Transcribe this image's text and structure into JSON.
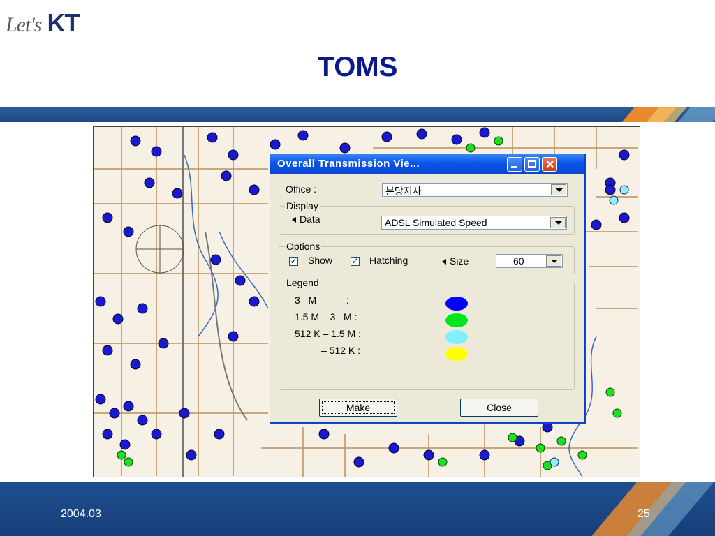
{
  "logo": {
    "lets": "Let's",
    "kt": "KT"
  },
  "slide_title": "TOMS",
  "dialog": {
    "title": "Overall Transmission Vie...",
    "office_label": "Office :",
    "office_value": "분당지사",
    "display_group": "Display",
    "data_label": "Data",
    "data_value": "ADSL Simulated Speed",
    "options_group": "Options",
    "show_label": "Show",
    "hatching_label": "Hatching",
    "size_label": "Size",
    "size_value": "60",
    "show_checked": true,
    "hatching_checked": true,
    "legend_group": "Legend",
    "legend": [
      {
        "label": "3   M –        :",
        "color": "#0000ff"
      },
      {
        "label": "1.5 M – 3   M :",
        "color": "#00e61e"
      },
      {
        "label": "512 K – 1.5 M :",
        "color": "#80f0ff"
      },
      {
        "label": "– 512 K :",
        "color": "#ffff00"
      }
    ],
    "make_button": "Make",
    "close_button": "Close"
  },
  "footer": {
    "date": "2004.03",
    "page": "25"
  },
  "colors": {
    "title": "#0a1a8c",
    "band": "#1e4f8f",
    "accent": "#f08a2a"
  }
}
